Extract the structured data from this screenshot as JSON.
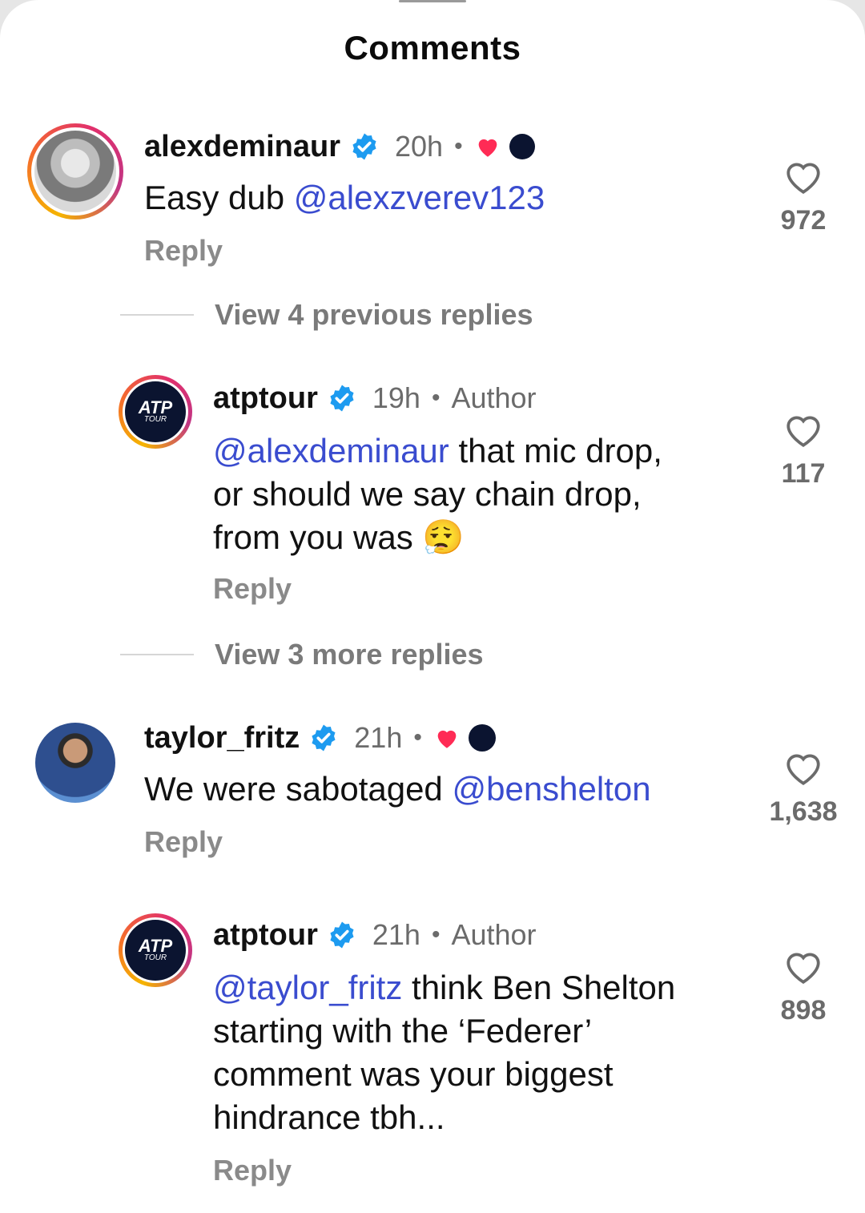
{
  "header": {
    "title": "Comments"
  },
  "comments": [
    {
      "username": "alexdeminaur",
      "time": "20h",
      "text_mention": "@alexzverev123",
      "text_prefix": "Easy dub ",
      "reply_label": "Reply",
      "likes": "972"
    },
    {
      "username": "atptour",
      "time": "19h",
      "author_label": "Author",
      "text_mention": "@alexdeminaur",
      "text_rest_1": " that mic drop,",
      "text_line_2": "or should we say chain drop,",
      "text_line_3": "from you was 😮‍💨",
      "reply_label": "Reply",
      "likes": "117",
      "avatar_text_1": "ATP",
      "avatar_text_2": "TOUR"
    },
    {
      "username": "taylor_fritz",
      "time": "21h",
      "text_prefix": "We were sabotaged ",
      "text_mention": "@benshelton",
      "reply_label": "Reply",
      "likes": "1,638"
    },
    {
      "username": "atptour",
      "time": "21h",
      "author_label": "Author",
      "text_mention": "@taylor_fritz",
      "text_rest_1": " think Ben Shelton",
      "text_line_2": "starting with the ‘Federer’",
      "text_line_3": "comment was your biggest",
      "text_line_4": "hindrance tbh...",
      "reply_label": "Reply",
      "likes": "898",
      "avatar_text_1": "ATP",
      "avatar_text_2": "TOUR"
    }
  ],
  "threads": {
    "view_previous": "View 4 previous replies",
    "view_more": "View 3 more replies"
  },
  "meta": {
    "dot": "•"
  },
  "colors": {
    "mention": "#3a4ccf",
    "verified": "#1d9bf0",
    "heart": "#ff2b55"
  }
}
